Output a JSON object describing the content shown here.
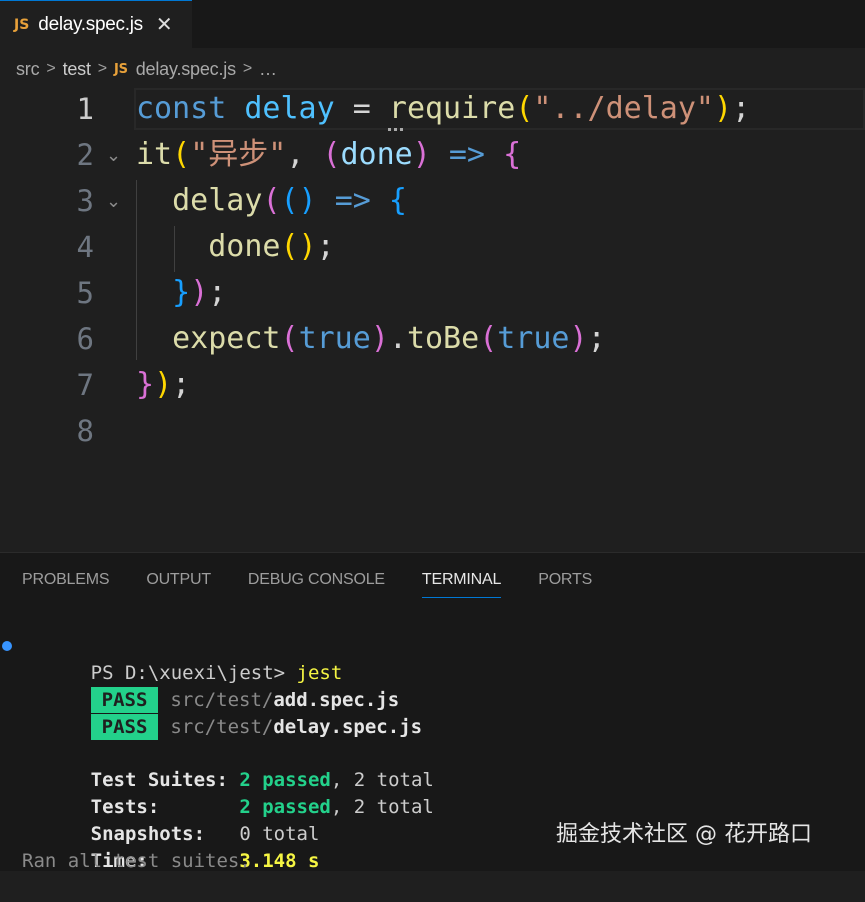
{
  "tab": {
    "icon": "JS",
    "label": "delay.spec.js",
    "close": "✕"
  },
  "breadcrumb": {
    "parts": [
      "src",
      "test"
    ],
    "icon": "JS",
    "file": "delay.spec.js",
    "more": "…",
    "sep": ">"
  },
  "editor": {
    "line_numbers": [
      "1",
      "2",
      "3",
      "4",
      "5",
      "6",
      "7",
      "8"
    ],
    "fold_marker": "⌄"
  },
  "panel": {
    "tabs": [
      "PROBLEMS",
      "OUTPUT",
      "DEBUG CONSOLE",
      "TERMINAL",
      "PORTS"
    ],
    "active_tab": "TERMINAL"
  },
  "terminal": {
    "prompt": "PS D:\\xuexi\\jest> ",
    "command": "jest",
    "pass_label": "PASS",
    "results": [
      {
        "dir": "src/test/",
        "file": "add.spec.js"
      },
      {
        "dir": "src/test/",
        "file": "delay.spec.js"
      }
    ],
    "suites_label": "Test Suites: ",
    "suites_passed": "2 passed",
    "suites_total": ", 2 total",
    "tests_label": "Tests:       ",
    "tests_passed": "2 passed",
    "tests_total": ", 2 total",
    "snapshots_label": "Snapshots:   ",
    "snapshots_value": "0 total",
    "time_label": "Time:        ",
    "time_value": "3.148 s",
    "footer": "Ran all test suites."
  },
  "watermark": "掘金技术社区 @ 花开路口",
  "colors": {
    "accent": "#0078d4",
    "pass_badge": "#23d18b",
    "js_icon": "#e8a13a"
  }
}
